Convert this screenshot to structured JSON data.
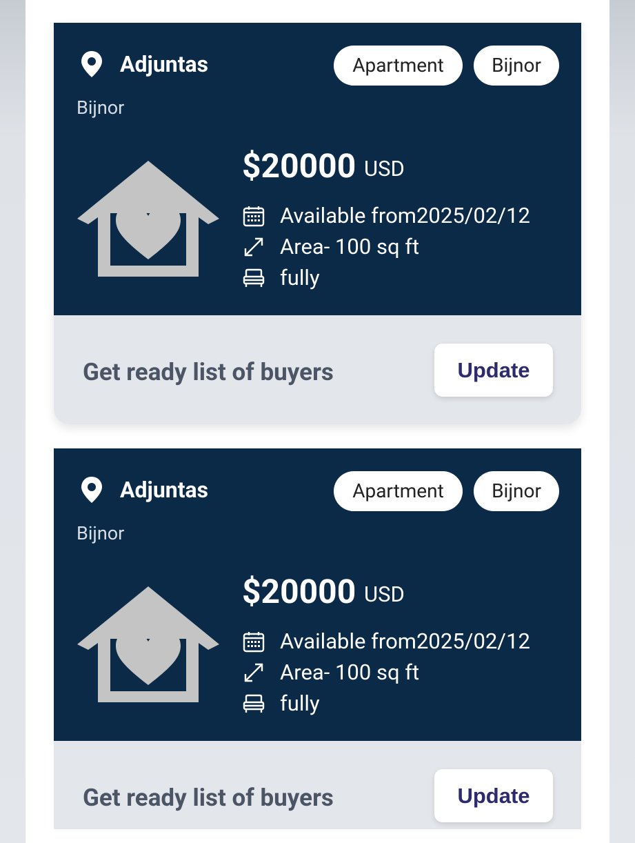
{
  "listings": [
    {
      "location": "Adjuntas",
      "sub_location": "Bijnor",
      "tags": [
        "Apartment",
        "Bijnor"
      ],
      "price": "$20000",
      "currency": "USD",
      "available": "Available from2025/02/12",
      "area": "Area- 100 sq ft",
      "furnishing": "fully",
      "footer_text": "Get ready list of buyers",
      "action_label": "Update"
    },
    {
      "location": "Adjuntas",
      "sub_location": "Bijnor",
      "tags": [
        "Apartment",
        "Bijnor"
      ],
      "price": "$20000",
      "currency": "USD",
      "available": "Available from2025/02/12",
      "area": "Area- 100 sq ft",
      "furnishing": "fully",
      "footer_text": "Get ready list of buyers",
      "action_label": "Update"
    }
  ],
  "colors": {
    "card_header_bg": "#0b2a47",
    "card_footer_bg": "#e3e6eb",
    "button_text": "#2d2a6e",
    "placeholder_icon": "#c4c4c4"
  },
  "icons": {
    "location": "map-pin-icon",
    "placeholder": "house-heart-icon",
    "date": "calendar-icon",
    "area": "expand-arrows-icon",
    "furnishing": "bed-icon"
  }
}
